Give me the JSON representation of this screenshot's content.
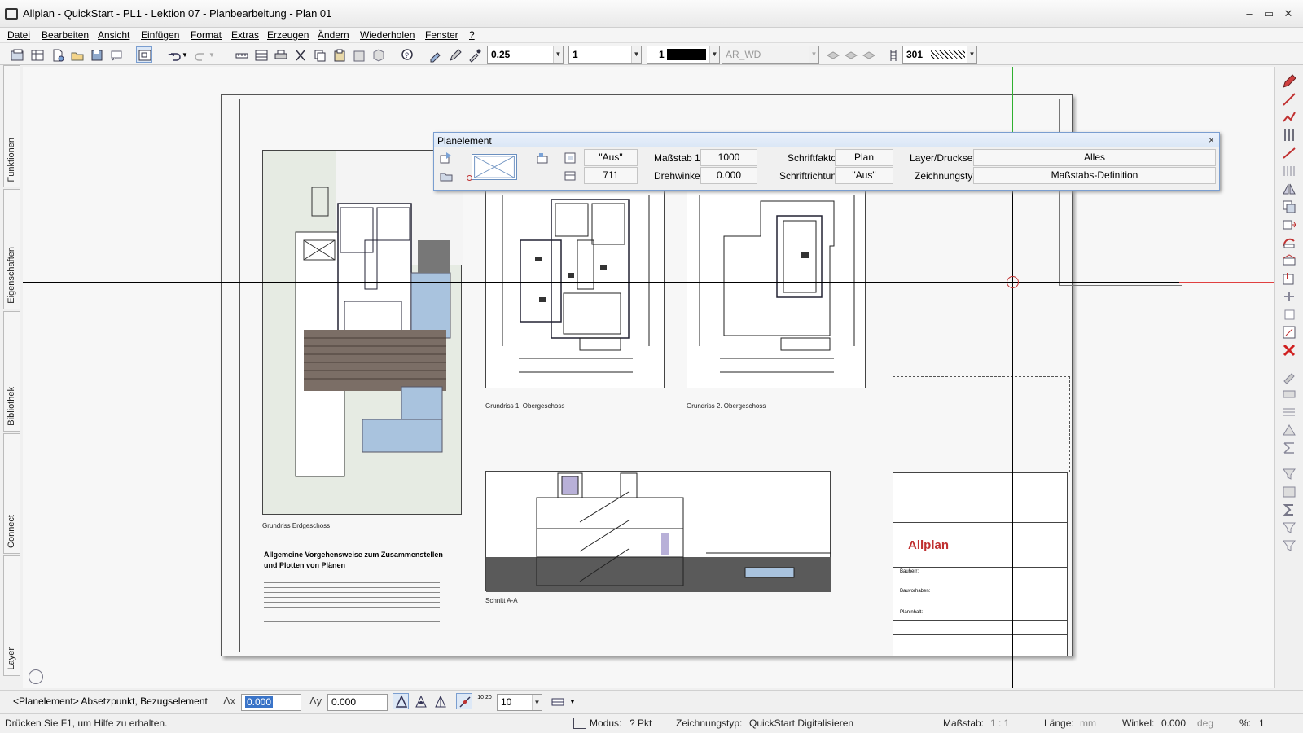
{
  "window": {
    "title": "Allplan - QuickStart - PL1 - Lektion 07 - Planbearbeitung - Plan 01",
    "minimize": "–",
    "maximize": "▭",
    "close": "✕"
  },
  "menu": {
    "items": [
      "Datei",
      "Bearbeiten",
      "Ansicht",
      "Einfügen",
      "Format",
      "Extras",
      "Erzeugen",
      "Ändern",
      "Wiederholen",
      "Fenster",
      "?"
    ]
  },
  "toolbar": {
    "pen_thickness": "0.25",
    "line_type": "1",
    "color_value": "1",
    "layer": "AR_WD",
    "pattern_number": "301"
  },
  "side_tabs": [
    "Funktionen",
    "Eigenschaften",
    "Bibliothek",
    "Connect",
    "Layer"
  ],
  "plan": {
    "captions": {
      "eg": "Grundriss Erdgeschoss",
      "og1": "Grundriss 1. Obergeschoss",
      "og2": "Grundriss 2. Obergeschoss",
      "section": "Schnitt A-A"
    },
    "text_heading_line1": "Allgemeine Vorgehensweise zum Zusammenstellen",
    "text_heading_line2": "und Plotten von Plänen",
    "title_block": {
      "logo": "Allplan",
      "bauherr_label": "Bauherr:",
      "bauvorhaben_label": "Bauvorhaben:",
      "planinhalt_label": "Planinhalt:"
    }
  },
  "dialog": {
    "title": "Planelement",
    "close": "×",
    "aus1": "\"Aus\"",
    "value711": "711",
    "massstab_label": "Maßstab 1:",
    "massstab_value": "1000",
    "drehwinkel_label": "Drehwinkel",
    "drehwinkel_value": "0.000",
    "schriftfaktor_label": "Schriftfaktor",
    "schriftfaktor_value": "Plan",
    "schriftrichtung_label": "Schriftrichtung",
    "schriftrichtung_value": "\"Aus\"",
    "layer_label": "Layer/Druckset",
    "layer_value": "Alles",
    "zeichnungstyp_label": "Zeichnungstyp",
    "zeichnungstyp_value": "Maßstabs-Definition"
  },
  "input_row": {
    "prompt": "<Planelement> Absetzpunkt, Bezugselement",
    "dx_label": "Δx",
    "dx_value": "0.000",
    "dy_label": "Δy",
    "dy_value": "0.000",
    "snap_label": "10 20",
    "step_value": "10"
  },
  "status": {
    "help": "Drücken Sie F1, um Hilfe zu erhalten.",
    "modus_label": "Modus:",
    "modus_value": "? Pkt",
    "zeichnungstyp_label": "Zeichnungstyp:",
    "zeichnungstyp_value": "QuickStart Digitalisieren",
    "massstab_label": "Maßstab:",
    "massstab_value": "1 : 1",
    "laenge_label": "Länge:",
    "laenge_unit": "mm",
    "winkel_label": "Winkel:",
    "winkel_value": "0.000",
    "winkel_unit": "deg",
    "percent_label": "%:",
    "percent_value": "1"
  }
}
